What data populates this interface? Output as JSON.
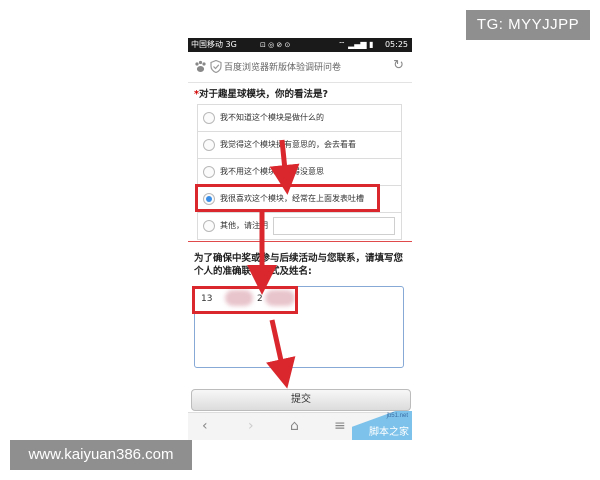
{
  "watermarks": {
    "top_right": "TG: MYYJJPP",
    "bottom_left": "www.kaiyuan386.com",
    "corner_url": "jb51.net",
    "corner_name": "脚本之家"
  },
  "statusbar": {
    "carrier": "中国移动 3G",
    "time": "05:25"
  },
  "header": {
    "title": "百度浏览器新版体验调研问卷"
  },
  "question": {
    "required_mark": "*",
    "text": "对于趣星球模块，你的看法是?"
  },
  "options": [
    {
      "label": "我不知道这个模块是做什么的",
      "selected": false
    },
    {
      "label": "我觉得这个模块挺有意思的，会去看看",
      "selected": false
    },
    {
      "label": "我不用这个模块，觉得没意思",
      "selected": false
    },
    {
      "label": "我很喜欢这个模块，经常在上面发表吐槽",
      "selected": true
    },
    {
      "label": "其他，请注明",
      "selected": false
    }
  ],
  "contact": {
    "question": "为了确保中奖或参与后续活动与您联系，请填写您个人的准确联系方式及姓名:",
    "value_prefix": "13",
    "value_mid": "2"
  },
  "submit_label": "提交",
  "colors": {
    "accent": "#3a8ee6",
    "highlight": "#d9272d",
    "required": "#d10000"
  }
}
